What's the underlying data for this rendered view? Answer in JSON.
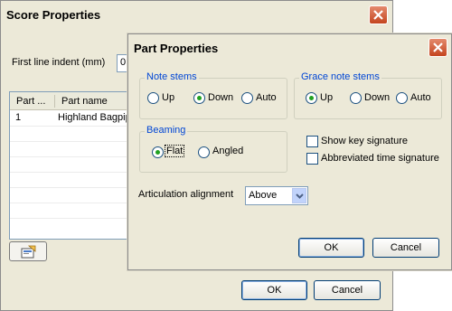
{
  "score_window": {
    "title": "Score Properties",
    "first_line_indent_label": "First line indent (mm)",
    "first_line_indent_value": "0",
    "parts_table": {
      "columns": [
        "Part ...",
        "Part name"
      ],
      "rows": [
        {
          "number": "1",
          "name": "Highland Bagpipe"
        }
      ]
    },
    "ok_label": "OK",
    "cancel_label": "Cancel"
  },
  "part_window": {
    "title": "Part Properties",
    "note_stems": {
      "label": "Note stems",
      "options": [
        "Up",
        "Down",
        "Auto"
      ],
      "selected": "Down"
    },
    "grace_note_stems": {
      "label": "Grace note stems",
      "options": [
        "Up",
        "Down",
        "Auto"
      ],
      "selected": "Up"
    },
    "beaming": {
      "label": "Beaming",
      "options": [
        "Flat",
        "Angled"
      ],
      "selected": "Flat"
    },
    "show_key_signature": {
      "label": "Show key signature",
      "checked": false
    },
    "abbreviated_time_signature": {
      "label": "Abbreviated time signature",
      "checked": false
    },
    "articulation_alignment": {
      "label": "Articulation alignment",
      "value": "Above"
    },
    "ok_label": "OK",
    "cancel_label": "Cancel"
  }
}
